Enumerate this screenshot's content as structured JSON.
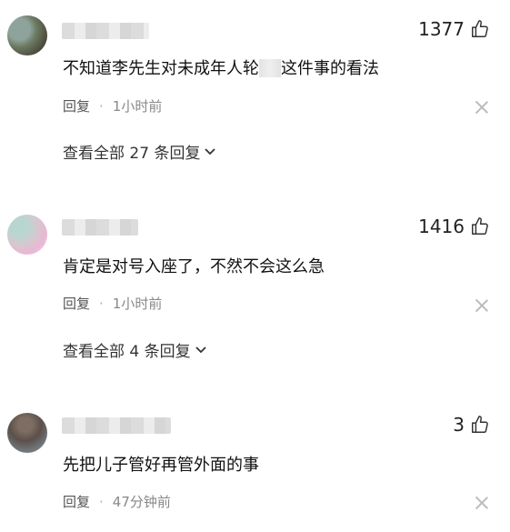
{
  "comments": [
    {
      "likes": "1377",
      "text_before": "不知道李先生对未成年人轮",
      "text_after": "这件事的看法",
      "reply_label": "回复",
      "separator": "·",
      "time": "1小时前",
      "view_replies": "查看全部 27 条回复"
    },
    {
      "likes": "1416",
      "text": "肯定是对号入座了，不然不会这么急",
      "reply_label": "回复",
      "separator": "·",
      "time": "1小时前",
      "view_replies": "查看全部 4 条回复"
    },
    {
      "likes": "3",
      "text": "先把儿子管好再管外面的事",
      "reply_label": "回复",
      "separator": "·",
      "time": "47分钟前"
    }
  ],
  "icons": {
    "like": "thumbs-up-icon",
    "close": "close-icon",
    "expand": "chevron-down-icon"
  },
  "colors": {
    "text": "#111111",
    "meta": "#888888",
    "close": "#bbbbbb"
  }
}
